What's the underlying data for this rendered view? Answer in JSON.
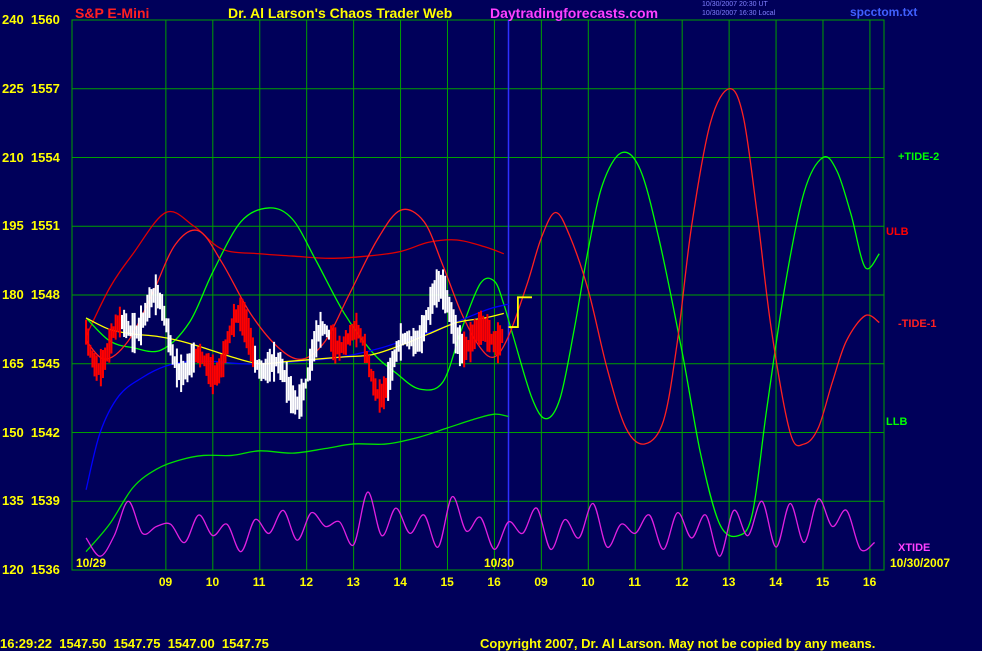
{
  "header": {
    "symbol": "S&P E-Mini",
    "title": "Dr. Al Larson's Chaos Trader Web",
    "site": "Daytradingforecasts.com",
    "timestamp1": "10/30/2007 20:30 UT",
    "timestamp2": "10/30/2007 16:30 Local",
    "filename": "spcctom.txt"
  },
  "footer": {
    "quote": "16:29:22  1547.50  1547.75  1547.00  1547.75",
    "copyright": "Copyright 2007, Dr. Al Larson. May not be copied by any means."
  },
  "colors": {
    "background": "#00005a",
    "grid": "#00a000",
    "price_bar_up": "#ffffff",
    "price_bar_down": "#ff0000",
    "ulb": "#e00000",
    "llb": "#00e000",
    "tide2": "#00ff00",
    "tide1": "#ff2020",
    "xtide": "#e020e0",
    "ma": "#0000ff",
    "avg": "#ffff00"
  },
  "chart_data": {
    "type": "line",
    "y_axis_left": [
      "120",
      "135",
      "150",
      "165",
      "180",
      "195",
      "210",
      "225",
      "240"
    ],
    "y_axis_price": [
      "1536",
      "1539",
      "1542",
      "1545",
      "1548",
      "1551",
      "1554",
      "1557",
      "1560"
    ],
    "ylim": [
      1536,
      1560
    ],
    "x_ticks_day1": [
      "09",
      "10",
      "11",
      "12",
      "13",
      "14",
      "15",
      "16"
    ],
    "x_ticks_day2": [
      "09",
      "10",
      "11",
      "12",
      "13",
      "14",
      "15",
      "16"
    ],
    "day_labels": [
      "10/29",
      "10/30",
      "10/30/2007"
    ],
    "grid": true,
    "series_labels": [
      {
        "name": "+TIDE-2",
        "color": "#00ff00",
        "price": 1554.0
      },
      {
        "name": "ULB",
        "color": "#ff0000",
        "price": 1550.7
      },
      {
        "name": "-TIDE-1",
        "color": "#ff2020",
        "price": 1546.7
      },
      {
        "name": "LLB",
        "color": "#00ff00",
        "price": 1542.4
      },
      {
        "name": "XTIDE",
        "color": "#ff40ff",
        "price": 1536.9
      }
    ],
    "series": [
      {
        "name": "ULB",
        "x": [
          7.3,
          7.8,
          8.3,
          9.0,
          9.6,
          10.2,
          11.0,
          11.7,
          12.5,
          13.3,
          14.0,
          14.6,
          15.2,
          15.8,
          16.2
        ],
        "y": [
          1546.2,
          1548.3,
          1549.8,
          1551.6,
          1551.0,
          1550.0,
          1549.8,
          1549.7,
          1549.6,
          1549.7,
          1549.9,
          1550.3,
          1550.4,
          1550.1,
          1549.8
        ]
      },
      {
        "name": "+TIDE-2",
        "x": [
          7.3,
          7.8,
          8.3,
          8.9,
          9.5,
          10.0,
          10.6,
          11.2,
          11.7,
          12.2,
          12.8,
          13.4,
          13.9,
          14.4,
          14.9,
          15.3,
          15.7,
          16.0,
          16.2,
          16.4,
          16.8,
          17.1,
          17.4,
          17.7,
          18.0,
          18.3,
          18.7,
          19.1,
          19.5,
          20.0,
          20.4,
          20.8,
          21.2,
          21.5,
          21.8,
          22.2,
          22.6,
          23.0,
          23.3,
          23.6,
          23.9,
          24.2
        ],
        "y": [
          1547.0,
          1546.0,
          1545.7,
          1545.6,
          1546.8,
          1549.0,
          1551.2,
          1551.8,
          1551.3,
          1549.5,
          1547.2,
          1545.5,
          1544.6,
          1543.9,
          1544.2,
          1546.5,
          1548.5,
          1548.6,
          1547.6,
          1546.2,
          1543.5,
          1542.6,
          1543.5,
          1546.5,
          1550.0,
          1552.8,
          1554.2,
          1553.5,
          1550.5,
          1545.5,
          1541.0,
          1538.0,
          1537.5,
          1538.5,
          1543.0,
          1548.5,
          1552.5,
          1554.0,
          1553.4,
          1551.5,
          1549.2,
          1549.8
        ]
      },
      {
        "name": "-TIDE-1",
        "x": [
          7.3,
          7.7,
          8.2,
          8.7,
          9.2,
          9.7,
          10.2,
          10.8,
          11.4,
          11.9,
          12.4,
          12.9,
          13.5,
          14.0,
          14.5,
          14.9,
          15.3,
          15.7,
          16.0,
          16.3,
          16.7,
          17.0,
          17.3,
          17.6,
          18.0,
          18.4,
          18.8,
          19.2,
          19.6,
          19.9,
          20.2,
          20.6,
          21.0,
          21.3,
          21.6,
          21.9,
          22.3,
          22.6,
          22.9,
          23.2,
          23.5,
          23.9,
          24.2
        ],
        "y": [
          1546.0,
          1545.2,
          1546.0,
          1548.0,
          1550.2,
          1550.8,
          1549.4,
          1547.2,
          1545.7,
          1545.2,
          1546.0,
          1548.0,
          1550.4,
          1551.7,
          1551.2,
          1549.3,
          1547.2,
          1545.7,
          1545.3,
          1546.2,
          1548.5,
          1550.5,
          1551.6,
          1550.6,
          1548.2,
          1544.8,
          1542.2,
          1541.5,
          1542.5,
          1546.0,
          1551.0,
          1555.5,
          1557.0,
          1555.8,
          1551.5,
          1546.5,
          1542.0,
          1541.5,
          1542.2,
          1544.2,
          1546.0,
          1547.1,
          1546.8
        ]
      },
      {
        "name": "LLB",
        "x": [
          7.3,
          7.8,
          8.3,
          8.8,
          9.3,
          9.8,
          10.4,
          11.0,
          11.7,
          12.4,
          13.0,
          13.7,
          14.4,
          15.0,
          15.6,
          16.0,
          16.3
        ],
        "y": [
          1536.8,
          1538.0,
          1539.6,
          1540.4,
          1540.8,
          1541.0,
          1541.0,
          1541.2,
          1541.1,
          1541.3,
          1541.5,
          1541.5,
          1541.8,
          1542.2,
          1542.6,
          1542.8,
          1542.7
        ]
      },
      {
        "name": "XTIDE",
        "x": [
          7.3,
          7.6,
          7.9,
          8.2,
          8.5,
          8.8,
          9.1,
          9.4,
          9.7,
          10.0,
          10.3,
          10.6,
          10.9,
          11.2,
          11.5,
          11.8,
          12.1,
          12.4,
          12.7,
          13.0,
          13.3,
          13.6,
          13.9,
          14.2,
          14.5,
          14.8,
          15.1,
          15.4,
          15.7,
          16.0,
          16.3,
          16.6,
          16.9,
          17.2,
          17.5,
          17.8,
          18.1,
          18.4,
          18.7,
          19.0,
          19.3,
          19.6,
          19.9,
          20.2,
          20.5,
          20.8,
          21.1,
          21.4,
          21.7,
          22.0,
          22.3,
          22.6,
          22.9,
          23.2,
          23.5,
          23.8,
          24.1
        ],
        "y": [
          1537.4,
          1536.6,
          1537.5,
          1539.0,
          1537.6,
          1537.9,
          1538.0,
          1537.2,
          1538.4,
          1537.5,
          1538.0,
          1536.8,
          1538.2,
          1537.6,
          1538.6,
          1537.3,
          1538.5,
          1537.9,
          1538.1,
          1537.1,
          1539.4,
          1537.5,
          1538.7,
          1537.6,
          1538.4,
          1537.0,
          1539.2,
          1537.7,
          1538.3,
          1536.9,
          1538.1,
          1537.6,
          1538.7,
          1536.9,
          1538.2,
          1537.4,
          1538.9,
          1537.0,
          1538.0,
          1537.6,
          1538.4,
          1536.9,
          1538.5,
          1537.4,
          1538.4,
          1536.6,
          1538.6,
          1537.5,
          1539.0,
          1537.0,
          1538.9,
          1537.2,
          1539.1,
          1537.9,
          1538.6,
          1536.9,
          1537.2
        ]
      },
      {
        "name": "MA",
        "x": [
          7.3,
          7.6,
          8.0,
          8.5,
          9.0,
          9.5,
          10.0,
          10.6,
          11.2,
          11.8,
          12.4,
          13.0,
          13.6,
          14.2,
          14.8,
          15.4,
          15.9,
          16.3
        ],
        "y": [
          1539.5,
          1542.0,
          1543.6,
          1544.4,
          1544.9,
          1545.1,
          1545.1,
          1545.0,
          1545.0,
          1545.1,
          1545.2,
          1545.4,
          1545.7,
          1546.1,
          1546.5,
          1547.0,
          1547.4,
          1547.6
        ]
      },
      {
        "name": "Avg",
        "x": [
          7.3,
          7.8,
          8.3,
          8.8,
          9.3,
          9.8,
          10.4,
          11.0,
          11.6,
          12.2,
          12.8,
          13.4,
          14.0,
          14.6,
          15.2,
          15.8,
          16.2
        ],
        "y": [
          1547.0,
          1546.5,
          1546.3,
          1546.2,
          1546.0,
          1545.7,
          1545.3,
          1545.0,
          1545.1,
          1545.2,
          1545.3,
          1545.4,
          1545.8,
          1546.3,
          1546.8,
          1547.0,
          1547.2
        ]
      },
      {
        "name": "Projection",
        "x": [
          16.3,
          16.5,
          16.5,
          16.8
        ],
        "y": [
          1546.6,
          1546.6,
          1547.9,
          1547.9
        ]
      }
    ]
  }
}
